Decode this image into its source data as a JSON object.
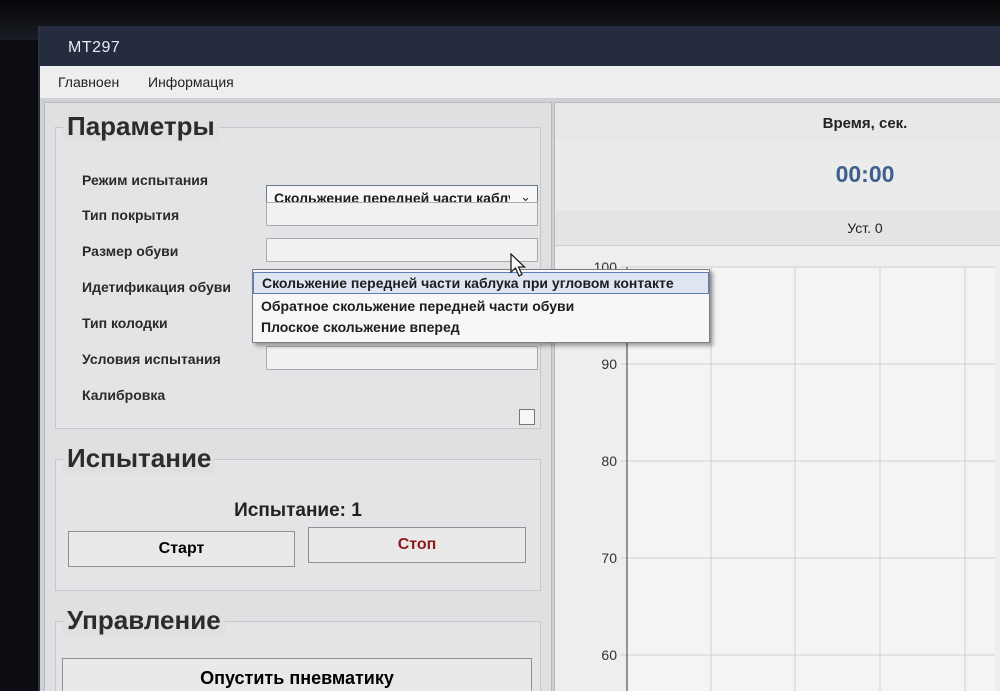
{
  "window": {
    "title": "MT297"
  },
  "menu": {
    "items": [
      {
        "label": "Главноен"
      },
      {
        "label": "Информация"
      }
    ]
  },
  "parameters": {
    "title": "Параметры",
    "fields": [
      {
        "label": "Режим испытания",
        "value": "Скольжение передней части каблука при угловом контакте"
      },
      {
        "label": "Тип покрытия",
        "value": ""
      },
      {
        "label": "Размер обуви",
        "value": ""
      },
      {
        "label": "Идетификация обуви",
        "value": ""
      },
      {
        "label": "Тип колодки",
        "value": ""
      },
      {
        "label": "Условия испытания",
        "value": ""
      },
      {
        "label": "Калибровка",
        "checked": false
      }
    ],
    "mode_options": [
      "Скольжение передней части каблука при угловом контакте",
      "Обратное скольжение передней части обуви",
      "Плоское скольжение вперед"
    ],
    "combo_arrow_icon": "chevron-down-icon"
  },
  "test": {
    "title": "Испытание",
    "counter_text": "Испытание: 1",
    "start_label": "Старт",
    "stop_label": "Стоп",
    "stop_color": "#8b1a1a"
  },
  "control": {
    "title": "Управление",
    "pneumatics_label": "Опустить пневматику"
  },
  "stats": {
    "time_header": "Время, сек.",
    "time_value": "00:00",
    "ust_label": "Уст. 0"
  },
  "colors": {
    "title_bar": "#262c40",
    "time_value": "#3f5f8f",
    "selected_item": "#dfe6f2"
  },
  "chart_data": {
    "type": "line",
    "ylim": [
      60,
      100
    ],
    "yticks": [
      "100",
      "90",
      "80",
      "70",
      "60"
    ],
    "series": [],
    "grid": true
  }
}
